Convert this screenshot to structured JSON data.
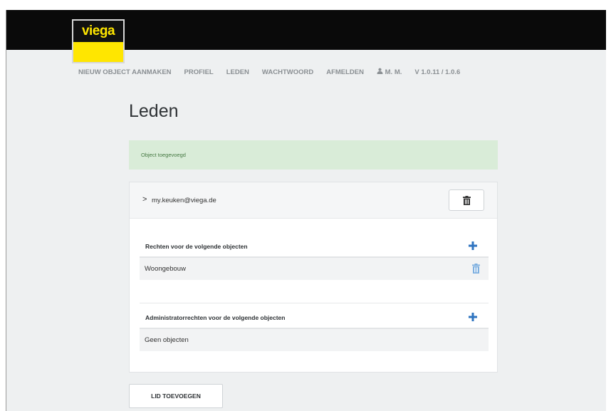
{
  "brand": {
    "logo_text": "viega",
    "accent": "#ffe600",
    "header_bg": "#0a0a0a"
  },
  "nav": {
    "items": [
      "NIEUW OBJECT AANMAKEN",
      "PROFIEL",
      "LEDEN",
      "WACHTWOORD",
      "AFMELDEN"
    ],
    "user": "M. M.",
    "version": "V 1.0.11 / 1.0.6"
  },
  "page": {
    "title": "Leden"
  },
  "alert": {
    "text": "Object toegevoegd",
    "bg": "#d9ecd8"
  },
  "member": {
    "email": "my.keuken@viega.de",
    "rights": {
      "title": "Rechten voor de volgende objecten",
      "items": [
        "Woongebouw"
      ]
    },
    "admin_rights": {
      "title": "Administratorrechten voor de volgende objecten",
      "empty_text": "Geen objecten"
    }
  },
  "actions": {
    "add_member": "LID TOEVOEGEN"
  },
  "colors": {
    "plus": "#2f74c0",
    "trash_blue": "#7fb0e0"
  }
}
